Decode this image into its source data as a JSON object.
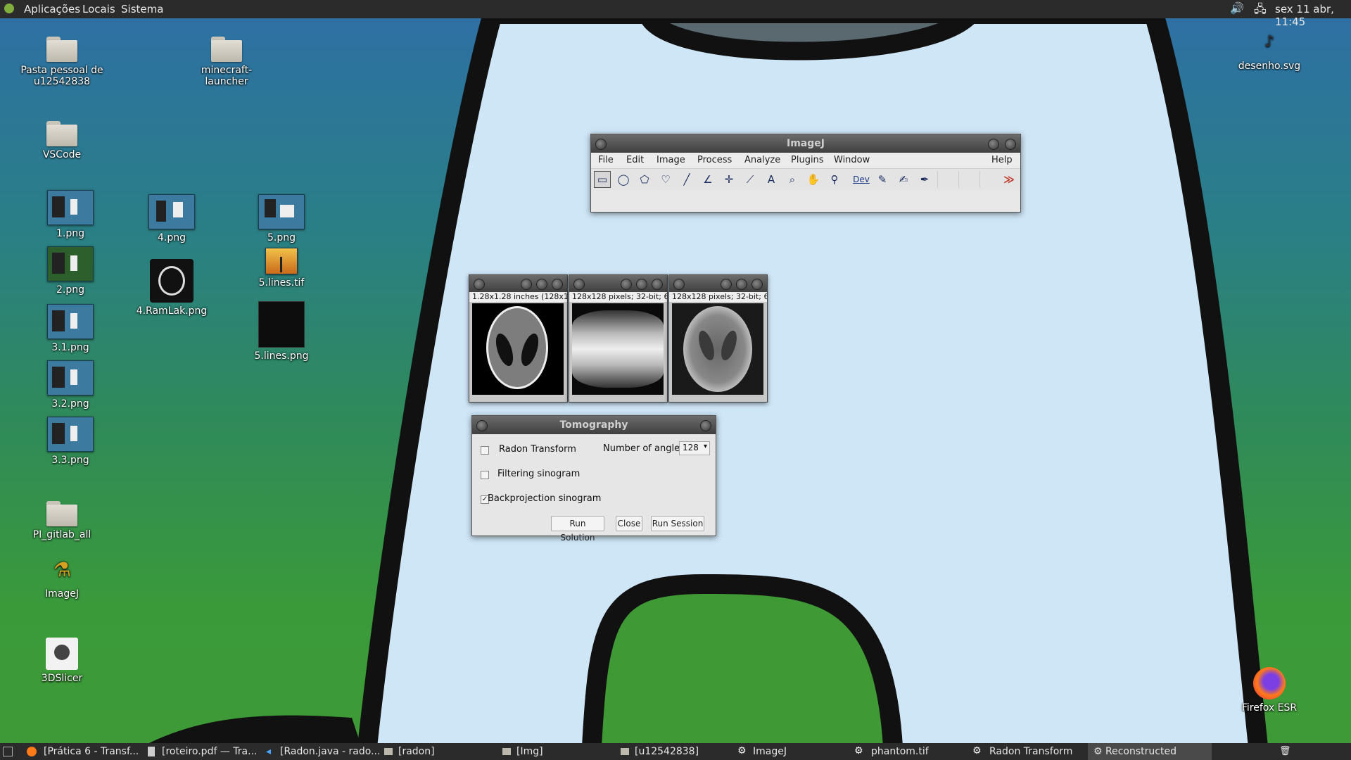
{
  "top_panel": {
    "menus": [
      "Aplicações",
      "Locais",
      "Sistema"
    ],
    "clock": "sex 11 abr, 11:45"
  },
  "desktop_icons": [
    {
      "label": "Pasta pessoal de u12542838",
      "icon": "home-folder-icon"
    },
    {
      "label": "minecraft-launcher",
      "icon": "folder-icon"
    },
    {
      "label": "desenho.svg",
      "icon": "svg-file-icon"
    },
    {
      "label": "VSCode",
      "icon": "folder-icon"
    },
    {
      "label": "1.png",
      "icon": "image-file-icon"
    },
    {
      "label": "4.png",
      "icon": "image-file-icon"
    },
    {
      "label": "5.png",
      "icon": "image-file-icon"
    },
    {
      "label": "2.png",
      "icon": "image-file-icon"
    },
    {
      "label": "4.RamLak.png",
      "icon": "image-file-icon"
    },
    {
      "label": "5.lines.tif",
      "icon": "image-file-icon"
    },
    {
      "label": "3.1.png",
      "icon": "image-file-icon"
    },
    {
      "label": "5.lines.png",
      "icon": "image-file-icon"
    },
    {
      "label": "3.2.png",
      "icon": "image-file-icon"
    },
    {
      "label": "3.3.png",
      "icon": "image-file-icon"
    },
    {
      "label": "PI_gitlab_all",
      "icon": "folder-icon"
    },
    {
      "label": "ImageJ",
      "icon": "imagej-icon"
    },
    {
      "label": "3DSlicer",
      "icon": "slicer-icon"
    },
    {
      "label": "Firefox ESR",
      "icon": "firefox-icon"
    }
  ],
  "imagej": {
    "title": "ImageJ",
    "menus": [
      "File",
      "Edit",
      "Image",
      "Process",
      "Analyze",
      "Plugins",
      "Window",
      "Help"
    ],
    "dev_label": "Dev"
  },
  "image_windows": [
    {
      "info": "1.28x1.28 inches (128x1"
    },
    {
      "info": "128x128 pixels; 32-bit; 6"
    },
    {
      "info": "128x128 pixels; 32-bit; 6"
    }
  ],
  "tomography": {
    "title": "Tomography",
    "radon_label": "Radon Transform",
    "angles_label": "Number of angles",
    "angles_value": "128",
    "filtering_label": "Filtering sinogram",
    "backprojection_label": "Backprojection sinogram",
    "backprojection_checked": true,
    "run_solution": "Run Solution",
    "close": "Close",
    "run_session": "Run Session"
  },
  "taskbar": {
    "items": [
      "[Prática 6 - Transf...",
      "[roteiro.pdf — Tra...",
      "[Radon.java - rado...",
      "[radon]",
      "[Img]",
      "[u12542838]",
      "ImageJ",
      "phantom.tif",
      "Radon Transform",
      "Reconstructed"
    ],
    "active_index": 9
  },
  "colors": {
    "panel": "#2b2b2b",
    "accent_red": "#c0392b"
  }
}
